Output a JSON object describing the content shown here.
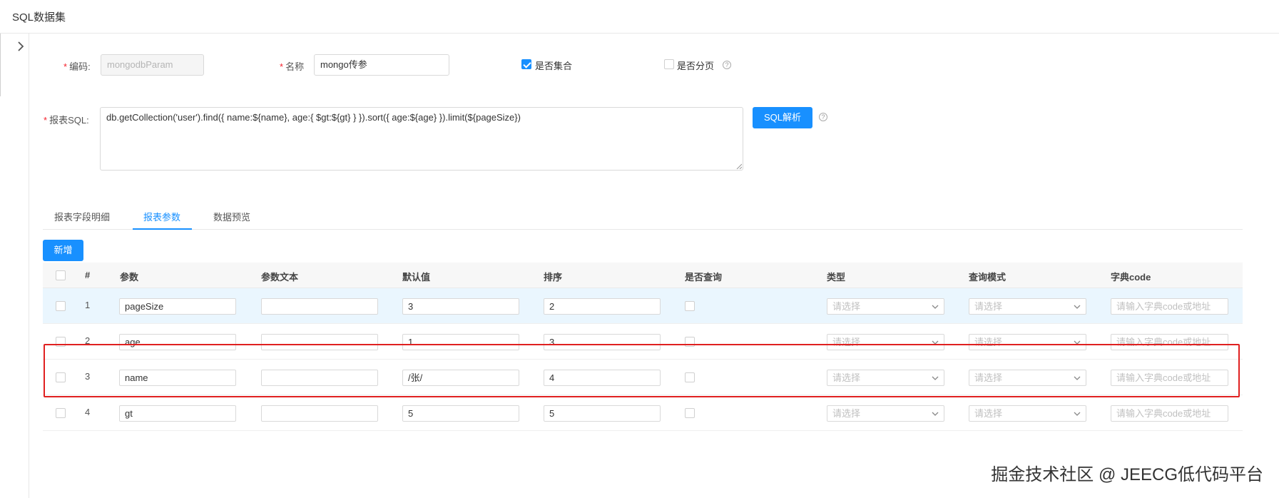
{
  "header": {
    "title": "SQL数据集"
  },
  "form": {
    "code_label": "编码:",
    "code_required": "*",
    "code_value": "mongodbParam",
    "name_label": "名称",
    "name_required": "*",
    "name_value": "mongo传参",
    "is_collection_label": "是否集合",
    "is_collection_checked": true,
    "is_paged_label": "是否分页",
    "is_paged_checked": false,
    "sql_label": "报表SQL:",
    "sql_required": "*",
    "sql_value": "db.getCollection('user').find({ name:${name}, age:{ $gt:${gt} } }).sort({ age:${age} }).limit(${pageSize})",
    "parse_button": "SQL解析",
    "help_glyph": "?"
  },
  "tabs": [
    {
      "label": "报表字段明细",
      "active": false
    },
    {
      "label": "报表参数",
      "active": true
    },
    {
      "label": "数据预览",
      "active": false
    }
  ],
  "toolbar": {
    "add_button": "新增"
  },
  "table": {
    "headers": [
      "#",
      "参数",
      "参数文本",
      "默认值",
      "排序",
      "是否查询",
      "类型",
      "查询模式",
      "字典code"
    ],
    "select_placeholder": "请选择",
    "dict_placeholder": "请输入字典code或地址",
    "rows": [
      {
        "index": "1",
        "param": "pageSize",
        "param_text": "",
        "default": "3",
        "order": "2",
        "highlighted": true
      },
      {
        "index": "2",
        "param": "age",
        "param_text": "",
        "default": "1",
        "order": "3",
        "highlighted": false
      },
      {
        "index": "3",
        "param": "name",
        "param_text": "",
        "default": "/张/",
        "order": "4",
        "highlighted": false
      },
      {
        "index": "4",
        "param": "gt",
        "param_text": "",
        "default": "5",
        "order": "5",
        "highlighted": false
      }
    ]
  },
  "watermark": "掘金技术社区 @ JEECG低代码平台",
  "colors": {
    "primary": "#1890ff",
    "required": "#f5222d",
    "highlight_box": "#e02020",
    "row_highlight": "#eaf6fe"
  }
}
